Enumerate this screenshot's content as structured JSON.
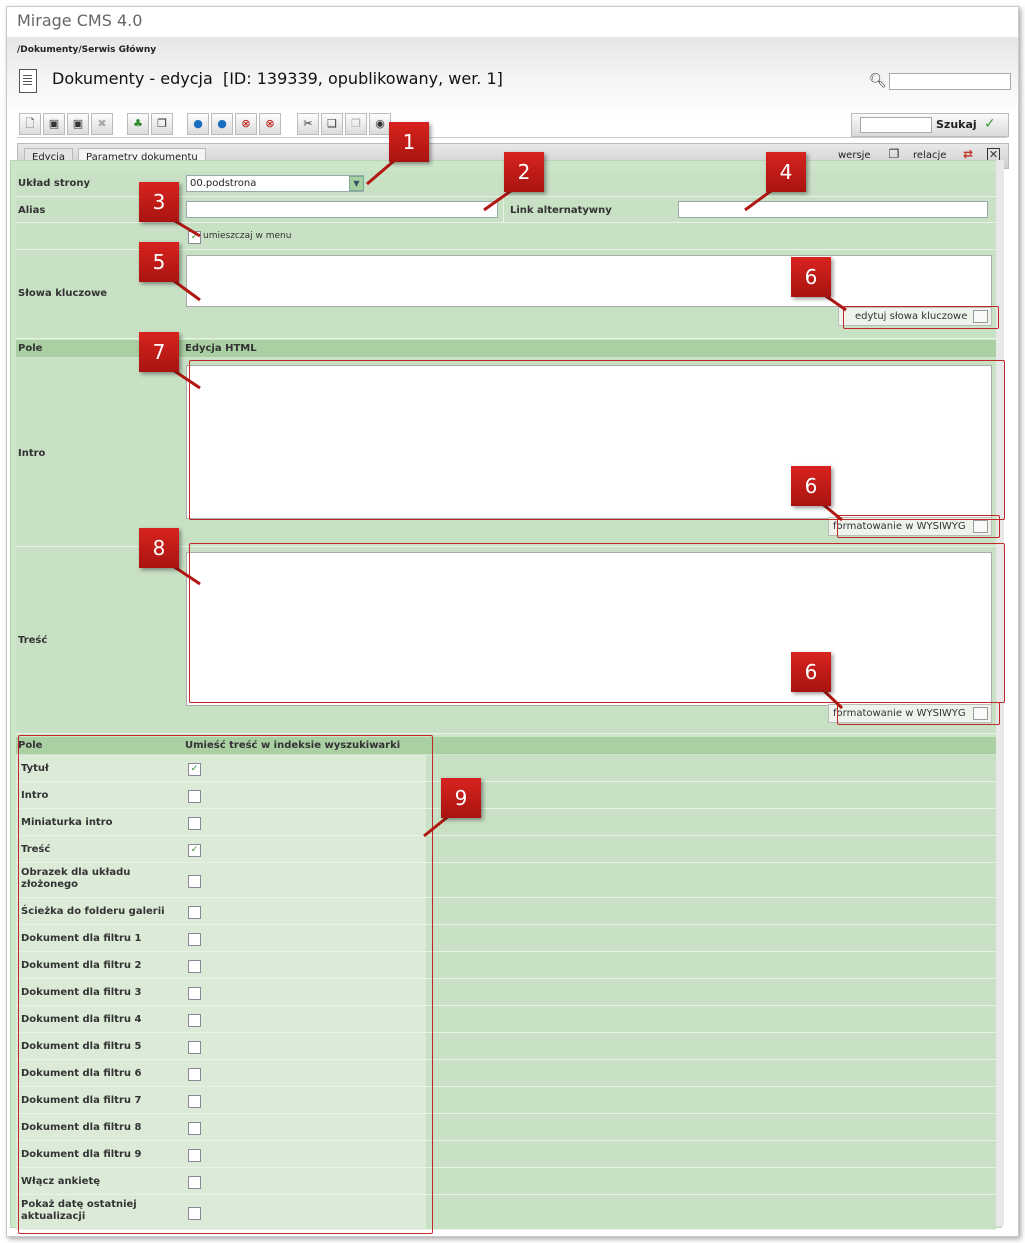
{
  "app": {
    "title": "Mirage CMS 4.0"
  },
  "header": {
    "breadcrumb": "/Dokumenty/Serwis Główny",
    "page_title": "Dokumenty - edycja  [ID: 139339, opublikowany, wer. 1]",
    "search_value": ""
  },
  "toolbar": {
    "buttons": [
      "new-doc-icon",
      "save-icon",
      "save-as-icon",
      "delete-icon",
      "tree-icon",
      "copy-icon",
      "publish-icon",
      "publish-all-icon",
      "unpublish-icon",
      "unpublish-all-icon",
      "cut-icon",
      "paste-icon",
      "clipboard-icon",
      "preview-icon"
    ],
    "search_value": "",
    "search_label": "Szukaj"
  },
  "tabs": {
    "items": [
      "Edycja",
      "Parametry dokumentu"
    ],
    "versions": "wersje",
    "relations": "relacje"
  },
  "form": {
    "layout_label": "Układ strony",
    "layout_value": "00.podstrona",
    "alias_label": "Alias",
    "alias_value": "",
    "alt_link_label": "Link alternatywny",
    "alt_link_value": "",
    "menu_checkbox_label": "umieszczaj w menu",
    "menu_checked": true,
    "keywords_label": "Słowa kluczowe",
    "keywords_value": "",
    "keywords_edit": "edytuj słowa kluczowe"
  },
  "fields": {
    "col_field": "Pole",
    "col_html": "Edycja HTML",
    "intro_label": "Intro",
    "content_label": "Treść",
    "wysiwyg": "formatowanie w WYSIWYG"
  },
  "index": {
    "col_field": "Pole",
    "col_index": "Umieść treść w indeksie wyszukiwarki",
    "rows": [
      {
        "label": "Tytuł",
        "checked": true
      },
      {
        "label": "Intro",
        "checked": false
      },
      {
        "label": "Miniaturka intro",
        "checked": false
      },
      {
        "label": "Treść",
        "checked": true
      },
      {
        "label": "Obrazek dla układu złożonego",
        "checked": false
      },
      {
        "label": "Ścieżka do folderu galerii",
        "checked": false
      },
      {
        "label": "Dokument dla filtru 1",
        "checked": false
      },
      {
        "label": "Dokument dla filtru 2",
        "checked": false
      },
      {
        "label": "Dokument dla filtru 3",
        "checked": false
      },
      {
        "label": "Dokument dla filtru 4",
        "checked": false
      },
      {
        "label": "Dokument dla filtru 5",
        "checked": false
      },
      {
        "label": "Dokument dla filtru 6",
        "checked": false
      },
      {
        "label": "Dokument dla filtru 7",
        "checked": false
      },
      {
        "label": "Dokument dla filtru 8",
        "checked": false
      },
      {
        "label": "Dokument dla filtru 9",
        "checked": false
      },
      {
        "label": "Włącz ankietę",
        "checked": false
      },
      {
        "label": "Pokaż datę ostatniej aktualizacji",
        "checked": false
      }
    ]
  },
  "callouts": [
    "1",
    "2",
    "3",
    "4",
    "5",
    "6",
    "7",
    "6",
    "8",
    "6",
    "9"
  ],
  "colors": {
    "accent_red": "#c0282a",
    "form_green": "#c8e0c4",
    "header_green": "#a9cfa2"
  }
}
